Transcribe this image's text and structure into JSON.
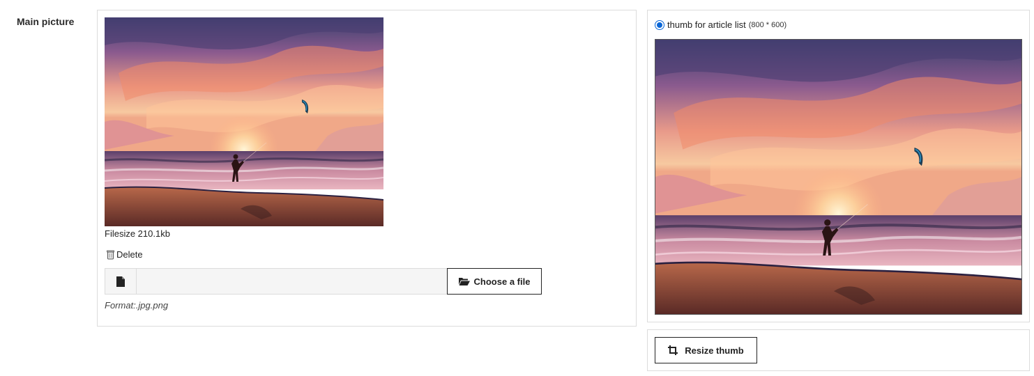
{
  "field": {
    "label": "Main picture"
  },
  "main": {
    "image_icon": "sunset-beach-kitesurfer-image",
    "filesize": "Filesize 210.1kb",
    "delete_label": "Delete",
    "delete_icon": "trash-icon",
    "file_icon": "file-icon",
    "file_input_value": "",
    "choose_label": "Choose a file",
    "choose_icon": "folder-open-icon",
    "format_note": "Format:.jpg.png"
  },
  "thumb": {
    "option_label": "thumb for article list",
    "option_dims": "(800 * 600)",
    "selected": true,
    "image_icon": "sunset-beach-kitesurfer-image"
  },
  "resize": {
    "label": "Resize thumb",
    "icon": "crop-icon"
  },
  "colors": {
    "accent": "#0a66d6",
    "border": "#dcdcdc",
    "button_border": "#222222"
  }
}
